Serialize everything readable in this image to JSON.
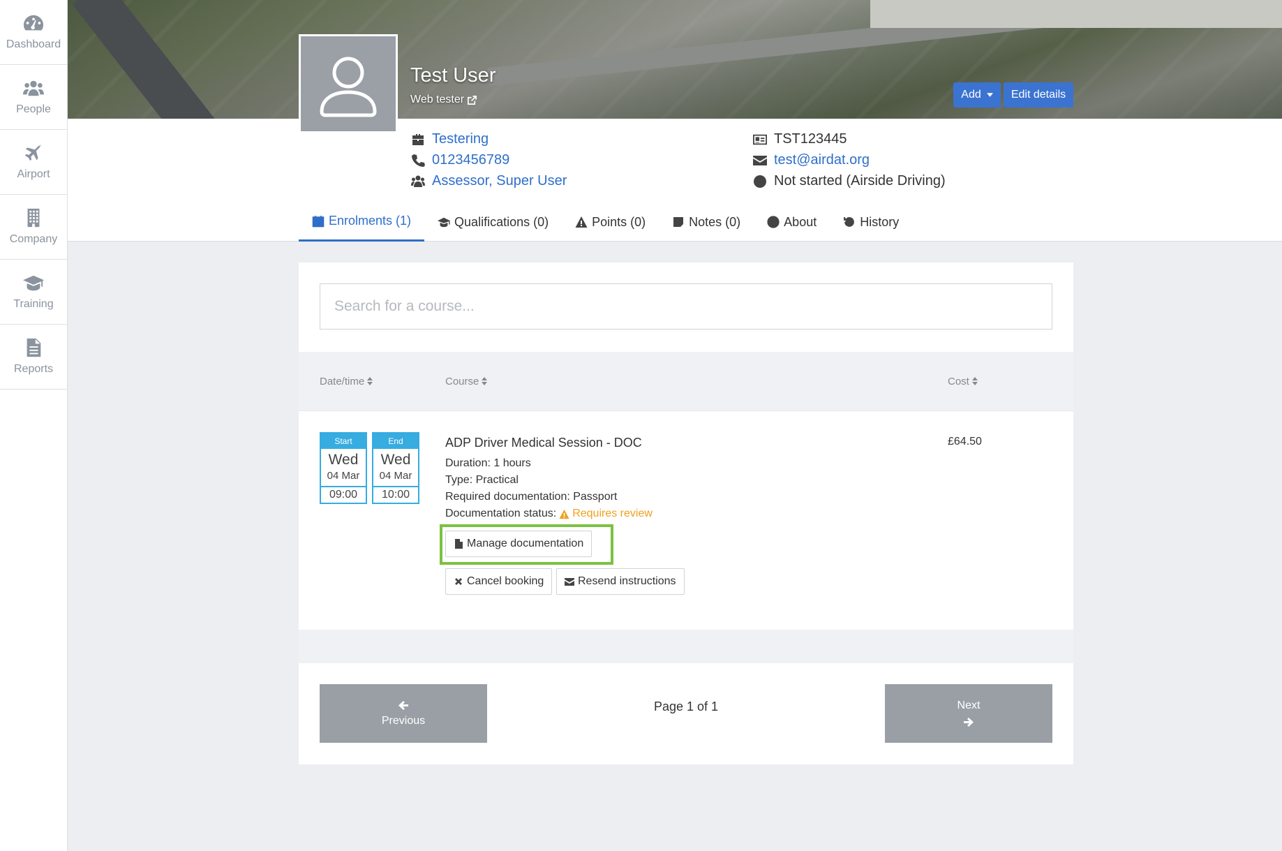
{
  "sidebar": {
    "items": [
      {
        "label": "Dashboard",
        "icon": "dashboard-icon"
      },
      {
        "label": "People",
        "icon": "people-icon"
      },
      {
        "label": "Airport",
        "icon": "plane-icon"
      },
      {
        "label": "Company",
        "icon": "building-icon"
      },
      {
        "label": "Training",
        "icon": "graduation-cap-icon"
      },
      {
        "label": "Reports",
        "icon": "document-icon"
      }
    ]
  },
  "profile": {
    "name": "Test User",
    "role": "Web tester",
    "add_label": "Add",
    "edit_label": "Edit details",
    "company": "Testering",
    "phone": "0123456789",
    "groups": "Assessor, Super User",
    "id_number": "TST123445",
    "email": "test@airdat.org",
    "status": "Not started (Airside Driving)"
  },
  "tabs": [
    {
      "label": "Enrolments (1)",
      "icon": "calendar-check-icon",
      "active": true
    },
    {
      "label": "Qualifications (0)",
      "icon": "graduation-cap-icon",
      "active": false
    },
    {
      "label": "Points (0)",
      "icon": "warning-icon",
      "active": false
    },
    {
      "label": "Notes (0)",
      "icon": "note-icon",
      "active": false
    },
    {
      "label": "About",
      "icon": "user-circle-icon",
      "active": false
    },
    {
      "label": "History",
      "icon": "history-icon",
      "active": false
    }
  ],
  "search": {
    "placeholder": "Search for a course...",
    "value": ""
  },
  "table": {
    "columns": [
      "Date/time",
      "Course",
      "Cost"
    ],
    "rows": [
      {
        "start": {
          "header": "Start",
          "day": "Wed",
          "date": "04 Mar",
          "time": "09:00"
        },
        "end": {
          "header": "End",
          "day": "Wed",
          "date": "04 Mar",
          "time": "10:00"
        },
        "course": "ADP Driver Medical Session - DOC",
        "duration": "Duration: 1 hours",
        "type": "Type: Practical",
        "required_docs": "Required documentation: Passport",
        "doc_status_label": "Documentation status:",
        "doc_status": "Requires review",
        "cost": "£64.50",
        "manage_label": "Manage documentation",
        "cancel_label": "Cancel booking",
        "resend_label": "Resend instructions"
      }
    ]
  },
  "pager": {
    "previous": "Previous",
    "next": "Next",
    "info": "Page 1 of 1"
  },
  "colors": {
    "accent": "#2f6fc9",
    "highlight": "#7cc142",
    "warning": "#f0a01c",
    "date_box": "#36ace0"
  }
}
